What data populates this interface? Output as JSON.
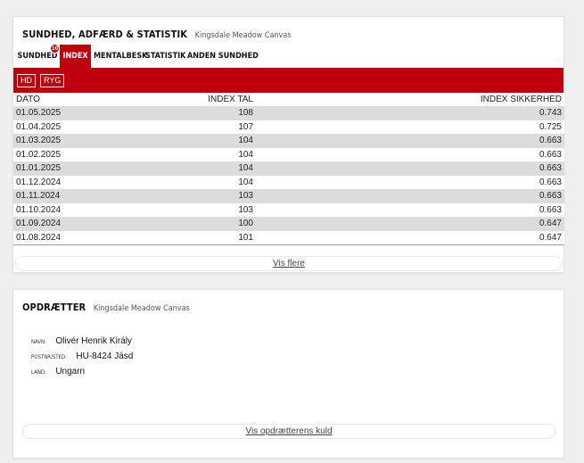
{
  "health": {
    "title": "Sundhed, Adfærd & Statistik",
    "subtitle": "Kingsdale Meadow Canvas",
    "tabs": [
      {
        "label": "Sundhed",
        "badge": "10"
      },
      {
        "label": "Index"
      },
      {
        "label": "Mentalbesk"
      },
      {
        "label": "Statistik"
      },
      {
        "label": "Anden sundhed"
      }
    ],
    "active_tab": "Index",
    "filters": [
      "HD",
      "RYG"
    ],
    "columns": [
      "DATO",
      "INDEX TAL",
      "INDEX SIKKERHED"
    ],
    "rows": [
      [
        "01.05.2025",
        "108",
        "0.743"
      ],
      [
        "01.04.2025",
        "107",
        "0.725"
      ],
      [
        "01.03.2025",
        "104",
        "0.663"
      ],
      [
        "01.02.2025",
        "104",
        "0.663"
      ],
      [
        "01.01.2025",
        "104",
        "0.663"
      ],
      [
        "01.12.2024",
        "104",
        "0.663"
      ],
      [
        "01.11.2024",
        "103",
        "0.663"
      ],
      [
        "01.10.2024",
        "103",
        "0.663"
      ],
      [
        "01.09.2024",
        "100",
        "0.647"
      ],
      [
        "01.08.2024",
        "101",
        "0.647"
      ]
    ],
    "more_label": "Vis flere"
  },
  "breeder": {
    "title": "Opdrætter",
    "subtitle": "Kingsdale Meadow Canvas",
    "fields": [
      {
        "label": "Navn:",
        "value": "Olivér Henrik Király"
      },
      {
        "label": "Postnr/Sted:",
        "value": "HU-8424 Jásd"
      },
      {
        "label": "Land:",
        "value": "Ungarn"
      }
    ],
    "litter_label": "Vis opdrætterens kuld"
  },
  "colors": {
    "accent": "#c0000c",
    "row_stripe": "#dcdcdc",
    "background": "#efefef"
  }
}
